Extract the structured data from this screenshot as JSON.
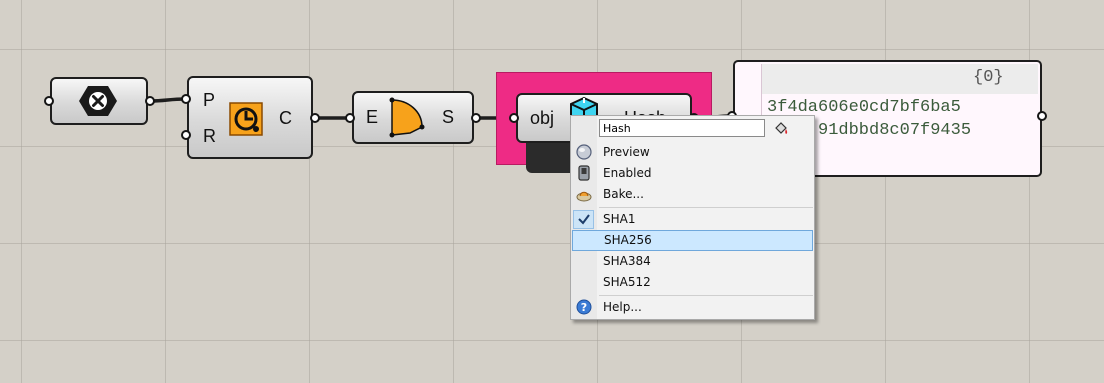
{
  "components": {
    "clear": {
      "icon": "x-hexagon-icon"
    },
    "first": {
      "input_p": "P",
      "input_r": "R",
      "output": "C",
      "icon": "orange-clock-icon"
    },
    "second": {
      "input": "E",
      "output": "S",
      "icon": "orange-shape-icon"
    },
    "hash": {
      "input": "obj",
      "output": "Hash",
      "icon": "cyan-box-icon"
    }
  },
  "panel": {
    "path": "{0}",
    "lines": [
      "3f4da606e0cd7bf6ba5",
      "91dbbd8c07f9435"
    ]
  },
  "menu": {
    "name_field": "Hash",
    "items": {
      "preview": "Preview",
      "enabled": "Enabled",
      "bake": "Bake...",
      "sha1": "SHA1",
      "sha256": "SHA256",
      "sha384": "SHA384",
      "sha512": "SHA512",
      "help": "Help..."
    },
    "checked_item": "SHA1",
    "highlighted_item": "SHA256"
  },
  "colors": {
    "canvas": "#d4d0c8",
    "group": "#ee2b85",
    "panel": "#fff7fd",
    "highlight": "#cce8ff",
    "icon_orange": "#f7a21b",
    "icon_cyan": "#3fd4f0"
  }
}
